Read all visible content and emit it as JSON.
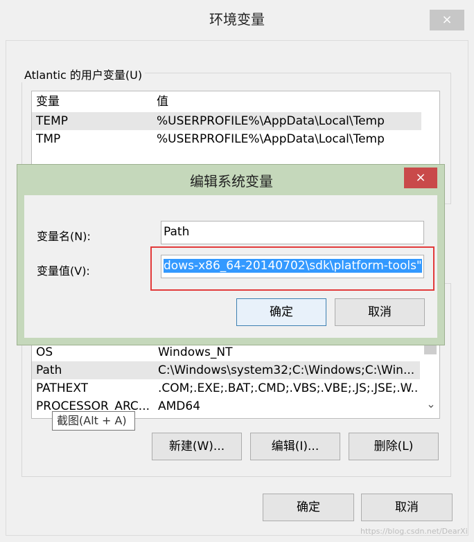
{
  "window": {
    "title": "环境变量",
    "close": "×"
  },
  "user_group": {
    "label": "Atlantic 的用户变量(U)",
    "headers": {
      "name": "变量",
      "value": "值"
    },
    "rows": [
      {
        "name": "TEMP",
        "value": "%USERPROFILE%\\AppData\\Local\\Temp"
      },
      {
        "name": "TMP",
        "value": "%USERPROFILE%\\AppData\\Local\\Temp"
      }
    ]
  },
  "system_list": {
    "rows": [
      {
        "name": "OS",
        "value": "Windows_NT"
      },
      {
        "name": "Path",
        "value": "C:\\Windows\\system32;C:\\Windows;C:\\Win..."
      },
      {
        "name": "PATHEXT",
        "value": ".COM;.EXE;.BAT;.CMD;.VBS;.VBE;.JS;.JSE;.W..."
      },
      {
        "name": "PROCESSOR_ARC...",
        "value": "AMD64"
      }
    ],
    "scroll_down": "⌄"
  },
  "tooltip": "截图(Alt + A)",
  "system_buttons": {
    "new": "新建(W)...",
    "edit": "编辑(I)...",
    "delete": "删除(L)"
  },
  "footer_buttons": {
    "ok": "确定",
    "cancel": "取消"
  },
  "dialog": {
    "title": "编辑系统变量",
    "close": "×",
    "name_label": "变量名(N):",
    "name_value": "Path",
    "value_label": "变量值(V):",
    "value_value": "dows-x86_64-20140702\\sdk\\platform-tools\"",
    "ok": "确定",
    "cancel": "取消"
  },
  "watermark": "https://blog.csdn.net/DearXi"
}
